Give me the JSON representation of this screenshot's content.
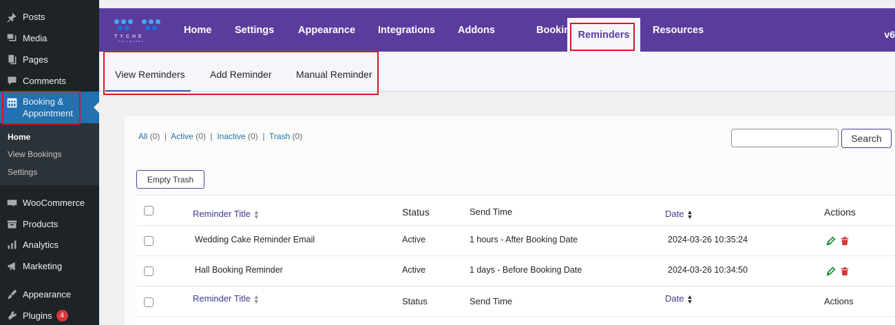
{
  "sidebar": {
    "items": [
      {
        "label": "Posts",
        "icon": "pin-icon"
      },
      {
        "label": "Media",
        "icon": "media-icon"
      },
      {
        "label": "Pages",
        "icon": "pages-icon"
      },
      {
        "label": "Comments",
        "icon": "comment-icon"
      },
      {
        "label": "Booking & Appointment",
        "icon": "calendar-grid-icon"
      },
      {
        "label": "WooCommerce",
        "icon": "woo-icon"
      },
      {
        "label": "Products",
        "icon": "box-icon"
      },
      {
        "label": "Analytics",
        "icon": "bar-chart-icon"
      },
      {
        "label": "Marketing",
        "icon": "megaphone-icon"
      },
      {
        "label": "Appearance",
        "icon": "brush-icon"
      },
      {
        "label": "Plugins",
        "icon": "plug-icon",
        "badge": "4"
      }
    ],
    "submenu": [
      "Home",
      "View Bookings",
      "Settings"
    ],
    "booking_label_line1": "Booking &",
    "booking_label_line2": "Appointment"
  },
  "header": {
    "logo_text": "TYCHE",
    "logo_sub": "SOFTWARES",
    "nav": [
      "Home",
      "Settings",
      "Appearance",
      "Integrations",
      "Addons",
      "Booking",
      "Reminders",
      "Resources"
    ],
    "active": "Reminders",
    "version": "v6"
  },
  "subtabs": [
    "View Reminders",
    "Add Reminder",
    "Manual Reminder"
  ],
  "filters": {
    "all": "All",
    "all_count": "(0)",
    "active": "Active",
    "active_count": "(0)",
    "inactive": "Inactive",
    "inactive_count": "(0)",
    "trash": "Trash",
    "trash_count": "(0)",
    "separator": "|"
  },
  "search": {
    "button": "Search",
    "value": ""
  },
  "empty_trash": "Empty Trash",
  "table": {
    "columns": [
      "Reminder Title",
      "Status",
      "Send Time",
      "Date",
      "Actions"
    ],
    "rows": [
      {
        "title": "Wedding Cake Reminder Email",
        "status": "Active",
        "send_time": "1 hours - After Booking Date",
        "date": "2024-03-26 10:35:24"
      },
      {
        "title": "Hall Booking Reminder",
        "status": "Active",
        "send_time": "1 days - Before Booking Date",
        "date": "2024-03-26 10:34:50"
      }
    ]
  },
  "colors": {
    "brand": "#5b3c9d",
    "wp_admin": "#1d2327",
    "highlight": "#e0101e",
    "edit": "#1e8a3a",
    "delete": "#d63638"
  }
}
